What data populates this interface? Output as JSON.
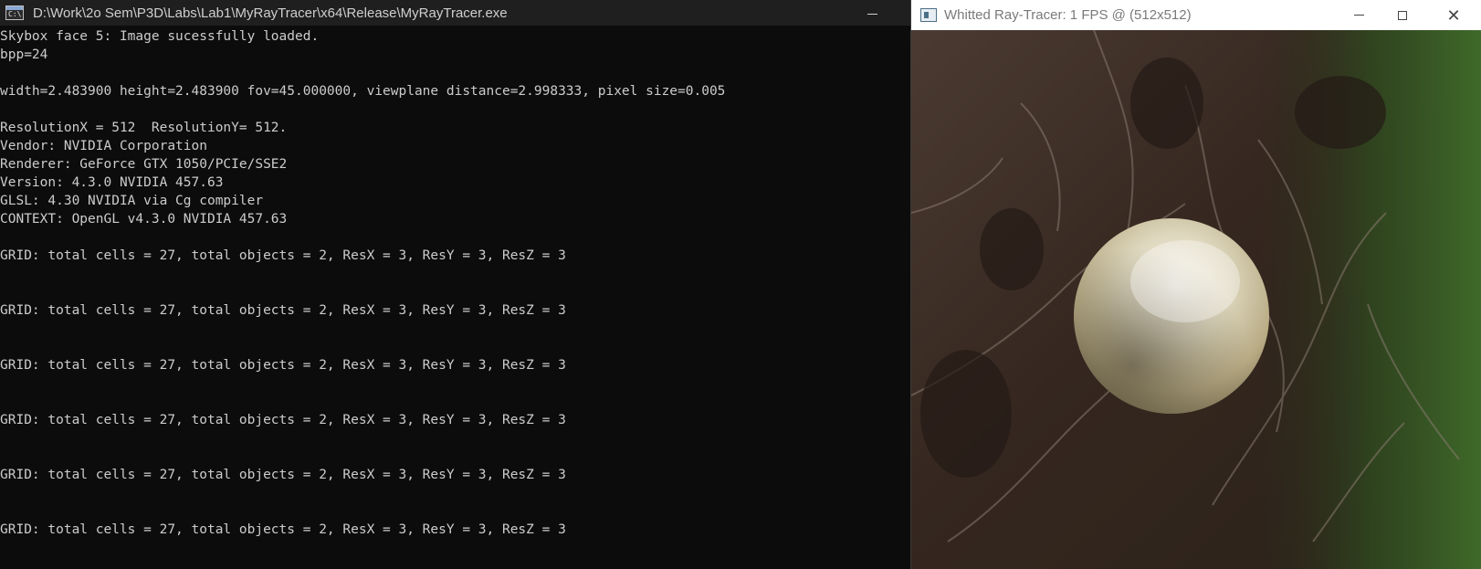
{
  "console": {
    "title": "D:\\Work\\2o Sem\\P3D\\Labs\\Lab1\\MyRayTracer\\x64\\Release\\MyRayTracer.exe",
    "icon": "C:\\",
    "lines": [
      "Skybox face 5: Image sucessfully loaded.",
      "bpp=24",
      "",
      "width=2.483900 height=2.483900 fov=45.000000, viewplane distance=2.998333, pixel size=0.005",
      "",
      "ResolutionX = 512  ResolutionY= 512.",
      "Vendor: NVIDIA Corporation",
      "Renderer: GeForce GTX 1050/PCIe/SSE2",
      "Version: 4.3.0 NVIDIA 457.63",
      "GLSL: 4.30 NVIDIA via Cg compiler",
      "CONTEXT: OpenGL v4.3.0 NVIDIA 457.63",
      "",
      "GRID: total cells = 27, total objects = 2, ResX = 3, ResY = 3, ResZ = 3",
      "",
      "",
      "GRID: total cells = 27, total objects = 2, ResX = 3, ResY = 3, ResZ = 3",
      "",
      "",
      "GRID: total cells = 27, total objects = 2, ResX = 3, ResY = 3, ResZ = 3",
      "",
      "",
      "GRID: total cells = 27, total objects = 2, ResX = 3, ResY = 3, ResZ = 3",
      "",
      "",
      "GRID: total cells = 27, total objects = 2, ResX = 3, ResY = 3, ResZ = 3",
      "",
      "",
      "GRID: total cells = 27, total objects = 2, ResX = 3, ResY = 3, ResZ = 3"
    ]
  },
  "viewer": {
    "title": "Whitted Ray-Tracer: 1 FPS @ (512x512)",
    "close_glyph": "✕"
  },
  "colors": {
    "console_bg": "#0c0c0c",
    "console_text": "#cccccc",
    "sphere": "#d8cfae",
    "ground": "#3a2a23"
  }
}
